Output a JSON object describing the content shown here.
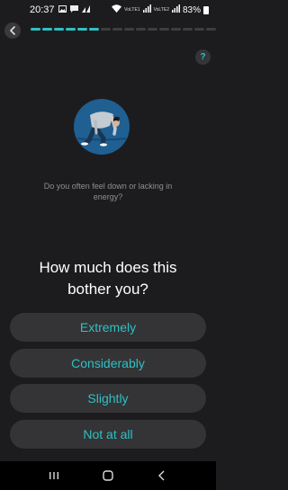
{
  "status_bar": {
    "time": "20:37",
    "notification_icons": [
      "gallery-icon",
      "message-icon",
      "signal-strength-icon"
    ],
    "network_labels": [
      "VoLTE1",
      "VoLTE2"
    ],
    "battery": "83%"
  },
  "progress": {
    "total": 16,
    "completed": 6
  },
  "help_label": "?",
  "question": "Do you often feel down or lacking in energy?",
  "prompt": "How much does this bother you?",
  "options": [
    "Extremely",
    "Considerably",
    "Slightly",
    "Not at all"
  ],
  "colors": {
    "accent": "#2fc0c4",
    "background": "#1c1c1e",
    "button": "#343436"
  }
}
